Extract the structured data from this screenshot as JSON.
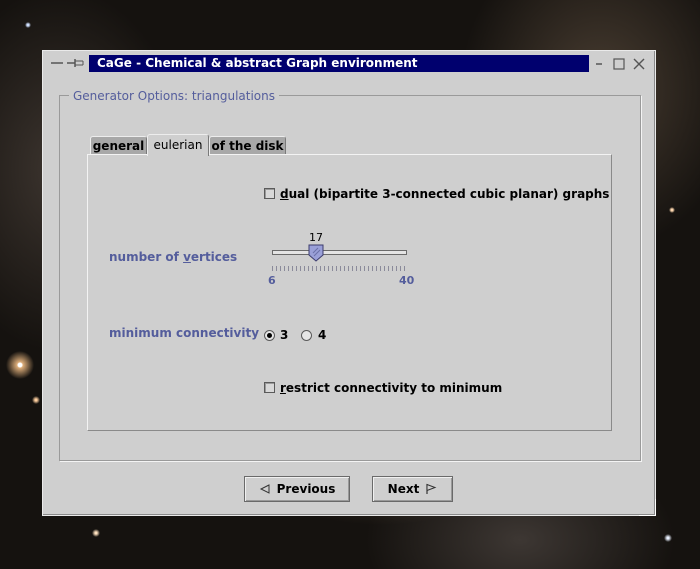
{
  "window": {
    "title": "CaGe - Chemical & abstract Graph environment"
  },
  "group": {
    "legend": "Generator Options:  triangulations"
  },
  "tabs": [
    {
      "label": "general",
      "active": false
    },
    {
      "label": "eulerian",
      "active": true
    },
    {
      "label": "of the disk",
      "active": false
    }
  ],
  "dual_option": {
    "mnemonic": "d",
    "label_rest": "ual (bipartite 3-connected cubic planar) graphs",
    "checked": false
  },
  "vertices": {
    "label_before": "number of ",
    "label_mnemonic": "v",
    "label_after": "ertices",
    "value": "17",
    "min": "6",
    "max": "40"
  },
  "connectivity": {
    "label": "minimum connectivity",
    "options": [
      {
        "label": "3",
        "selected": true
      },
      {
        "label": "4",
        "selected": false
      }
    ]
  },
  "restrict_option": {
    "mnemonic": "r",
    "label_rest": "estrict connectivity to minimum",
    "checked": false
  },
  "buttons": {
    "previous": "Previous",
    "next": "Next"
  },
  "colors": {
    "title_bar": "#00006e",
    "label_blue": "#545d9c",
    "window_bg": "#cfcfcf"
  },
  "icons": {
    "previous": "triangle-left-icon",
    "next": "flag-icon",
    "minimize": "minimize-icon",
    "maximize": "maximize-icon",
    "close": "close-icon",
    "menu": "window-menu-icon",
    "pin": "pin-icon"
  }
}
